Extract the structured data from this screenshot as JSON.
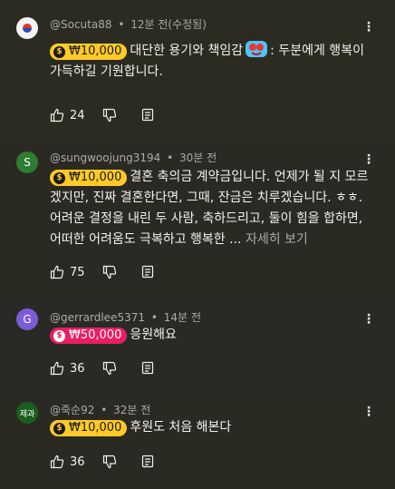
{
  "comments": [
    {
      "avatar": "",
      "avatar_icon": "korean-flag-icon",
      "handle": "@Socuta88",
      "separator": "•",
      "time": "12분 전(수정됨)",
      "chip": {
        "amount": "₩10,000",
        "color": "#ffca28"
      },
      "text_before_emoji": "대단한 용기와 책임감",
      "emoji": "heart-eyes-emoji-icon",
      "text_after_emoji": ": 두분에게 행복이 가득하길 기원합니다.",
      "likes": "24"
    },
    {
      "avatar": "S",
      "handle": "@sungwoojung3194",
      "separator": "•",
      "time": "30분 전",
      "chip": {
        "amount": "₩10,000",
        "color": "#ffca28"
      },
      "text": "결혼 축의금 계약금입니다. 언제가 될 지 모르겠지만, 진짜 결혼한다면, 그때, 잔금은 치루겠습니다. ㅎㅎ. 어려운 결정을 내린 두 사람, 축하드리고, 둘이 힘을 합하면, 어떠한 어려움도 극복하고 행복한 ...",
      "more": "자세히 보기",
      "likes": "75"
    },
    {
      "avatar": "G",
      "handle": "@gerrardlee5371",
      "separator": "•",
      "time": "14분 전",
      "chip": {
        "amount": "₩50,000",
        "color": "#e91e63"
      },
      "text": "응원해요",
      "likes": "36"
    },
    {
      "avatar": "제과",
      "handle": "@죽순92",
      "separator": "•",
      "time": "32분 전",
      "chip": {
        "amount": "₩10,000",
        "color": "#ffca28"
      },
      "text": "후원도 처음 해본다",
      "likes": "36"
    }
  ],
  "icons": {
    "like": "thumb-up-icon",
    "dislike": "thumb-down-icon",
    "reply": "reply-icon",
    "menu": "more-vert-icon",
    "coin": "dollar-coin-icon"
  },
  "coin_glyph": "$",
  "menu_glyph": "⋮"
}
